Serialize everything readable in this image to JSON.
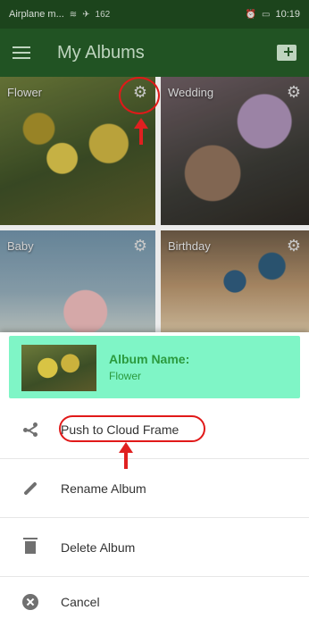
{
  "status_bar": {
    "left_text": "Airplane m...",
    "data_speed": "162",
    "time": "10:19"
  },
  "app_bar": {
    "title": "My Albums",
    "menu_icon": "hamburger-menu-icon",
    "add_icon": "add-folder-icon"
  },
  "albums": [
    {
      "name": "Flower"
    },
    {
      "name": "Wedding"
    },
    {
      "name": "Baby"
    },
    {
      "name": "Birthday"
    }
  ],
  "sheet": {
    "album_name_label": "Album Name:",
    "album_name_value": "Flower",
    "items": [
      {
        "label": "Push to Cloud Frame",
        "icon": "share-icon"
      },
      {
        "label": "Rename Album",
        "icon": "pencil-icon"
      },
      {
        "label": "Delete Album",
        "icon": "trash-icon"
      },
      {
        "label": "Cancel",
        "icon": "cancel-icon"
      }
    ]
  },
  "colors": {
    "app_bar": "#245b27",
    "header_bg": "#7ff5c6",
    "album_name_text": "#2b9a3e",
    "annotation_red": "#e11919"
  }
}
